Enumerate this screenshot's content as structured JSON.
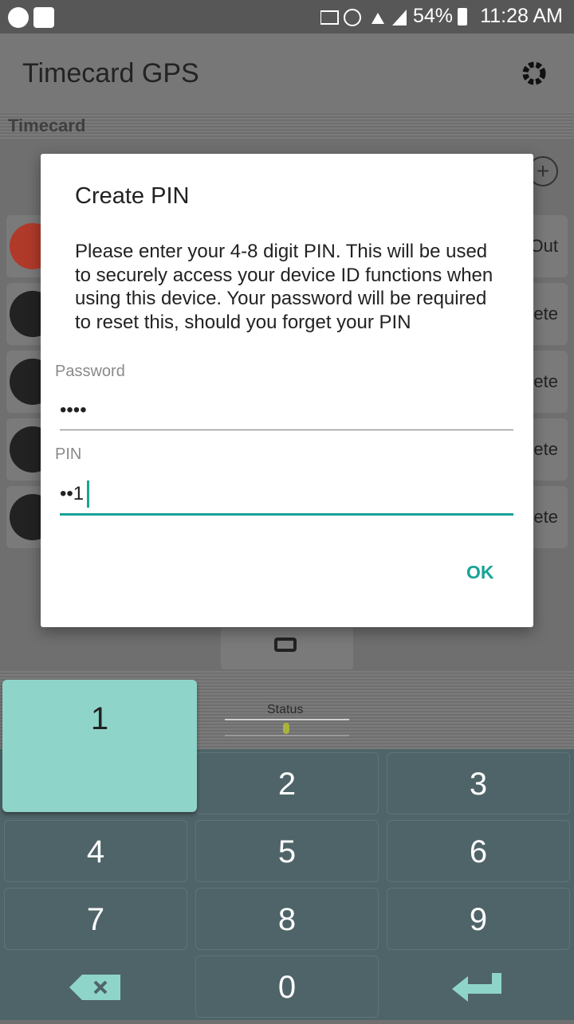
{
  "status_bar": {
    "battery": "54%",
    "time": "11:28 AM"
  },
  "app_bar": {
    "title": "Timecard GPS"
  },
  "section": {
    "title": "Timecard"
  },
  "background_rows": [
    {
      "label": "Out"
    },
    {
      "label": "ete"
    },
    {
      "label": "ete"
    },
    {
      "label": "ete"
    },
    {
      "label": "ete"
    }
  ],
  "bottom_strip": {
    "status_label": "Status"
  },
  "dialog": {
    "title": "Create PIN",
    "message": "Please enter your 4-8 digit PIN. This will be used to securely access your device ID functions when using this device. Your password will be required to reset this, should you forget your PIN",
    "password_label": "Password",
    "password_value": "••••",
    "pin_label": "PIN",
    "pin_value": "••1",
    "ok_label": "OK"
  },
  "keypad": {
    "keys": [
      "1",
      "2",
      "3",
      "4",
      "5",
      "6",
      "7",
      "8",
      "9",
      "0"
    ],
    "accent": "#8fd4c9",
    "background": "#4f6468"
  },
  "colors": {
    "accent": "#17a397"
  }
}
